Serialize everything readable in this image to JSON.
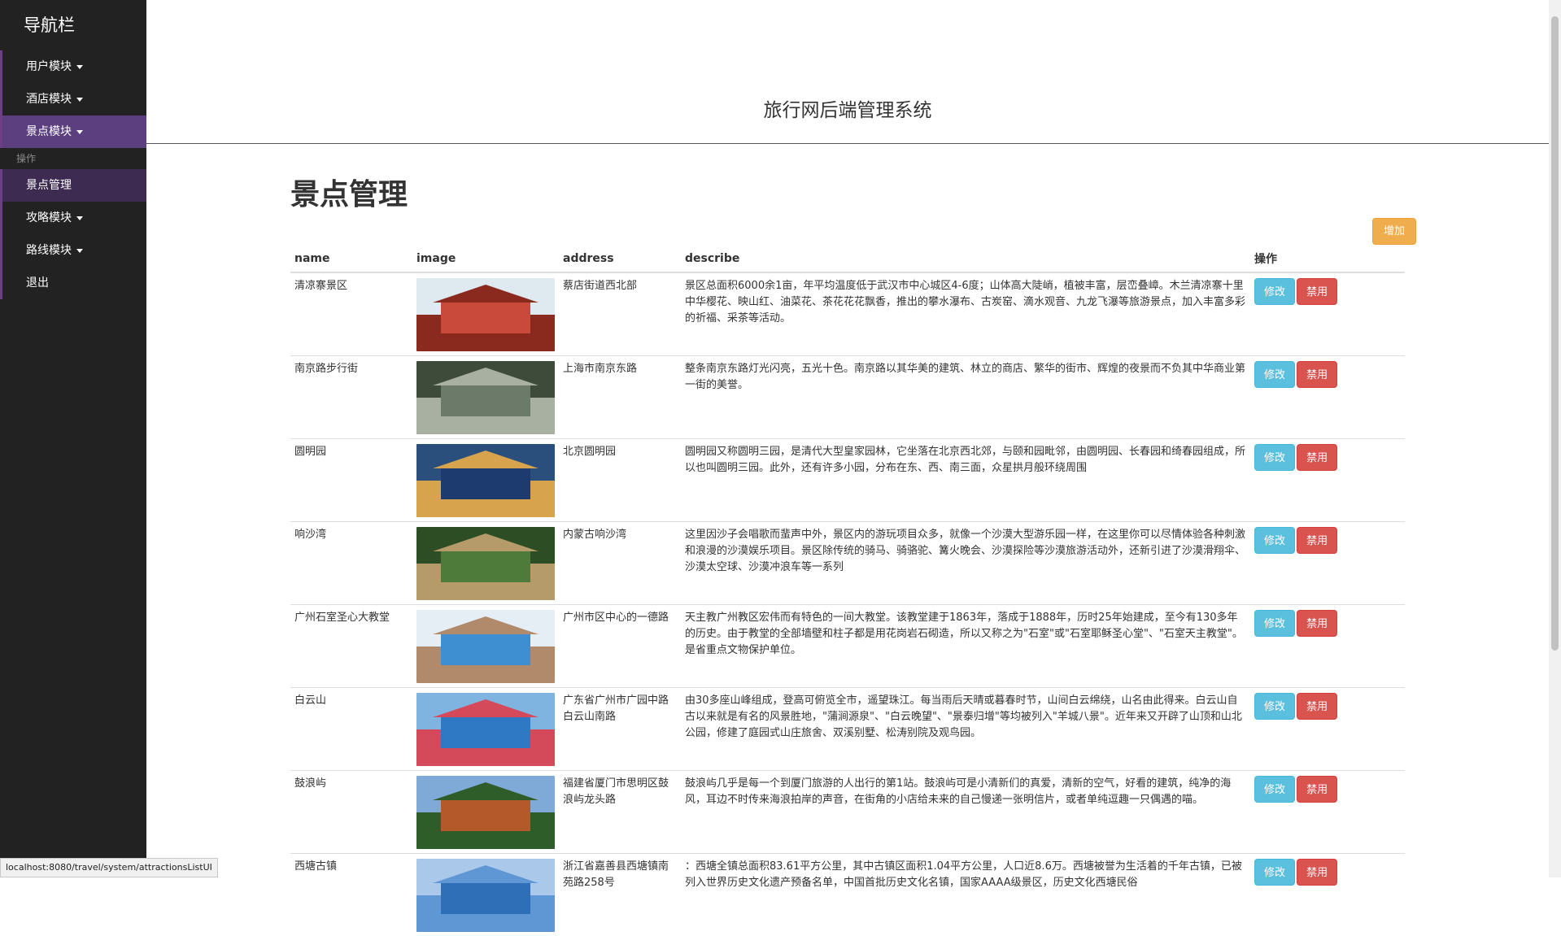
{
  "sidebar": {
    "brand": "导航栏",
    "items": [
      {
        "label": "用户模块"
      },
      {
        "label": "酒店模块"
      },
      {
        "label": "景点模块"
      }
    ],
    "section_header": "操作",
    "sub_item": "景点管理",
    "items_after": [
      {
        "label": "攻略模块"
      },
      {
        "label": "路线模块"
      }
    ],
    "logout": "退出"
  },
  "header": {
    "title": "旅行网后端管理系统"
  },
  "main": {
    "page_title": "景点管理",
    "add_button": "增加",
    "columns": [
      "name",
      "image",
      "address",
      "describe",
      "操作"
    ],
    "rows": [
      {
        "name": "清凉寨景区",
        "address": "蔡店街道西北部",
        "describe": "景区总面积6000余1亩，年平均温度低于武汉市中心城区4-6度；山体高大陡峭，植被丰富，层峦叠嶂。木兰清凉寨十里中华樱花、映山红、油菜花、茶花花花飘香，推出的攀水瀑布、古炭窑、滴水观音、九龙飞瀑等旅游景点，加入丰富多彩的祈福、采茶等活动。",
        "image": "photo-palace"
      },
      {
        "name": "南京路步行街",
        "address": "上海市南京东路",
        "describe": "整条南京东路灯光闪亮，五光十色。南京路以其华美的建筑、林立的商店、繁华的街市、辉煌的夜景而不负其中华商业第一街的美誉。",
        "image": "photo-cliff-carvings"
      },
      {
        "name": "圆明园",
        "address": "北京圆明园",
        "describe": "圆明园又称圆明三园，是清代大型皇家园林，它坐落在北京西北郊，与颐和园毗邻，由圆明园、长春园和绮春园组成，所以也叫圆明三园。此外，还有许多小园，分布在东、西、南三面，众星拱月般环绕周围",
        "image": "photo-water-town"
      },
      {
        "name": "响沙湾",
        "address": "内蒙古响沙湾",
        "describe": "这里因沙子会唱歌而蜚声中外，景区内的游玩项目众多，就像一个沙漠大型游乐园一样，在这里你可以尽情体验各种刺激和浪漫的沙漠娱乐项目。景区除传统的骑马、骑骆驼、篝火晚会、沙漠探险等沙漠旅游活动外，还新引进了沙漠滑翔伞、沙漠太空球、沙漠冲浪车等一系列",
        "image": "photo-giraffes"
      },
      {
        "name": "广州石室圣心大教堂",
        "address": "广州市区中心的一德路",
        "describe": "天主教广州教区宏伟而有特色的一间大教堂。该教堂建于1863年，落成于1888年，历时25年始建成，至今有130多年的历史。由于教堂的全部墙壁和柱子都是用花岗岩石砌造，所以又称之为\"石室\"或\"石室耶稣圣心堂\"、\"石室天主教堂\"。是省重点文物保护单位。",
        "image": "photo-rocks-sea"
      },
      {
        "name": "白云山",
        "address": "广东省广州市广园中路白云山南路",
        "describe": "由30多座山峰组成，登高可俯览全市，遥望珠江。每当雨后天晴或暮春时节，山间白云绵绕，山名由此得来。白云山自古以来就是有名的风景胜地，\"蒲涧源泉\"、\"白云晚望\"、\"景泰归增\"等均被列入\"羊城八景\"。近年来又开辟了山顶和山北公园，修建了庭园式山庄旅舍、双溪别墅、松涛别院及观鸟园。",
        "image": "photo-seaside-heart"
      },
      {
        "name": "鼓浪屿",
        "address": "福建省厦门市思明区鼓浪屿龙头路",
        "describe": "鼓浪屿几乎是每一个到厦门旅游的人出行的第1站。鼓浪屿可是小清新们的真爱，清新的空气，好看的建筑，纯净的海风，耳边不时传来海浪拍岸的声音，在街角的小店给未来的自己慢递一张明信片，或者单纯逗趣一只偶遇的喵。",
        "image": "photo-temple"
      },
      {
        "name": "西塘古镇",
        "address": "浙江省嘉善县西塘镇南苑路258号",
        "describe": "：西塘全镇总面积83.61平方公里，其中古镇区面积1.04平方公里，人口近8.6万。西塘被誉为生活着的千年古镇，已被列入世界历史文化遗产预备名单，中国首批历史文化名镇，国家AAAA级景区，历史文化西塘民俗",
        "image": "photo-sky"
      }
    ],
    "edit_label": "修改",
    "disable_label": "禁用"
  },
  "status_url": "localhost:8080/travel/system/attractionsListUI"
}
